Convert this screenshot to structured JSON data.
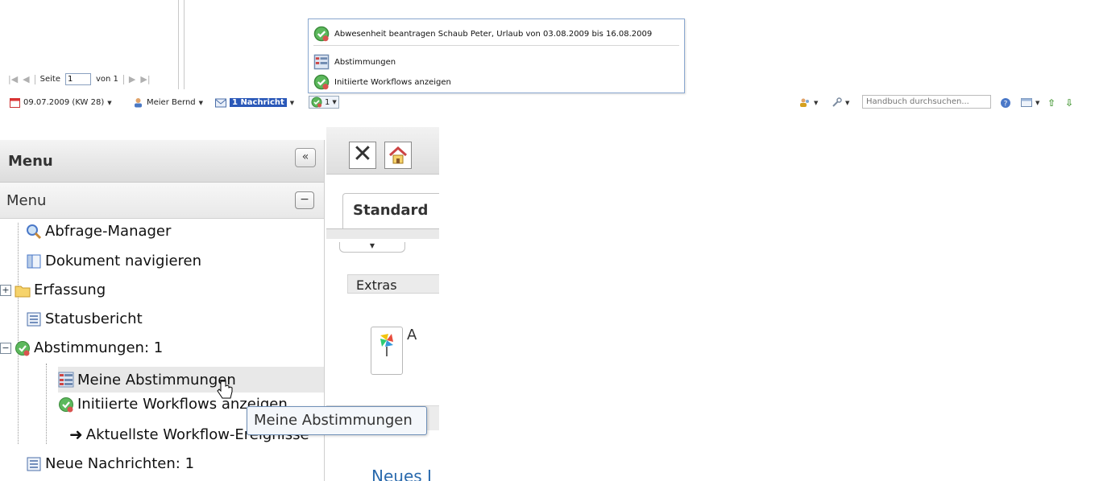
{
  "pager": {
    "page_label": "Seite",
    "page_value": "1",
    "of_label": "von 1"
  },
  "dropdown": {
    "items": [
      {
        "label": "Abwesenheit beantragen Schaub Peter, Urlaub von 03.08.2009 bis 16.08.2009",
        "icon": "workflow-check-icon"
      },
      {
        "label": "Abstimmungen",
        "icon": "list-grid-icon"
      },
      {
        "label": "Initiierte Workflows anzeigen",
        "icon": "workflow-check-icon"
      }
    ]
  },
  "toolbar": {
    "date": "09.07.2009 (KW 28)",
    "user": "Meier Bernd",
    "messages": "1 Nachricht",
    "workflow_count": "1",
    "search_placeholder": "Handbuch durchsuchen..."
  },
  "menu": {
    "title": "Menu",
    "collapse_symbol": "«",
    "section_title": "Menu",
    "section_toggle": "−",
    "items": [
      {
        "label": "Abfrage-Manager",
        "icon": "magnifier-icon"
      },
      {
        "label": "Dokument navigieren",
        "icon": "document-nav-icon"
      },
      {
        "label": "Erfassung",
        "icon": "folder-icon",
        "toggle": "+"
      },
      {
        "label": "Statusbericht",
        "icon": "report-icon"
      },
      {
        "label": "Abstimmungen: 1",
        "icon": "workflow-check-icon",
        "toggle": "−"
      },
      {
        "label": "Meine Abstimmungen",
        "icon": "list-grid-icon"
      },
      {
        "label": "Initiierte Workflows anzeigen",
        "icon": "workflow-check-icon"
      },
      {
        "label": "Aktuellste Workflow-Ereignisse",
        "icon": "arrow-right-icon"
      },
      {
        "label": "Neue Nachrichten: 1",
        "icon": "report-icon"
      }
    ]
  },
  "tooltip": {
    "text": "Meine Abstimmungen"
  },
  "content": {
    "tab_label": "Standard",
    "extras_label": "Extras",
    "partial_char": "A",
    "link_partial": "Neues I"
  },
  "colors": {
    "accent": "#2a58b8",
    "link": "#2a6aad",
    "border": "#8aa8d0"
  }
}
